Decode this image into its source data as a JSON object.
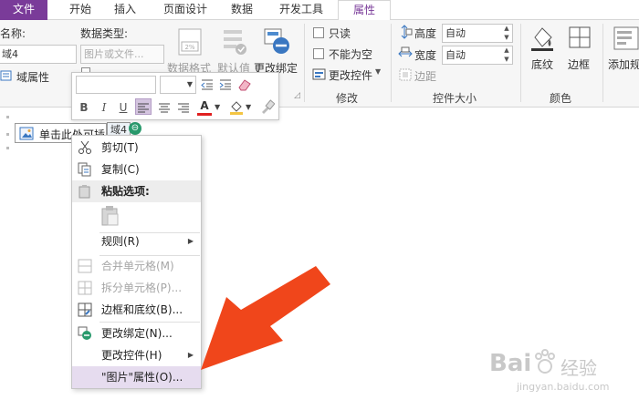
{
  "tabs": [
    {
      "label": "文件"
    },
    {
      "label": "开始"
    },
    {
      "label": "插入"
    },
    {
      "label": "页面设计"
    },
    {
      "label": "数据"
    },
    {
      "label": "开发工具"
    },
    {
      "label": "属性"
    }
  ],
  "ribbon": {
    "name_label": "名称:",
    "name_value": "域4",
    "field_props_label": "域属性",
    "data_type_label": "数据类型:",
    "data_type_value": "图片或文件...",
    "data_format_label": "数据格式",
    "data_format_badge": "2%",
    "default_value_label": "默认值",
    "change_binding_label": "更改绑定",
    "readonly_label": "只读",
    "not_empty_label": "不能为空",
    "change_control_label": "更改控件",
    "modify_group_label": "修改",
    "height_label": "高度",
    "height_value": "自动",
    "width_label": "宽度",
    "width_value": "自动",
    "margin_label": "边距",
    "control_size_group_label": "控件大小",
    "shading_label": "底纹",
    "border_label": "边框",
    "add_rule_label": "添加规",
    "color_group_label": "颜色"
  },
  "document": {
    "control_text": "单击此处可插",
    "control_tag": "域4"
  },
  "context_menu": {
    "cut": "剪切(T)",
    "copy": "复制(C)",
    "paste_options": "粘贴选项:",
    "rules": "规则(R)",
    "merge_cells": "合并单元格(M)",
    "split_cells": "拆分单元格(P)...",
    "borders_shading": "边框和底纹(B)...",
    "change_binding": "更改绑定(N)...",
    "change_control": "更改控件(H)",
    "picture_properties": "\"图片\"属性(O)..."
  },
  "watermark": {
    "brand": "Bai",
    "brand_cn": "经验",
    "url": "jingyan.baidu.com"
  },
  "colors": {
    "file_tab": "#7a3b99",
    "accent": "#7a3b99",
    "arrow": "#f0461b",
    "menu_highlight": "#e6dcef",
    "font_color_bar": "#e02020"
  },
  "icons": [
    "cut-icon",
    "copy-icon",
    "paste-icon",
    "merge-cells-icon",
    "split-cells-icon",
    "borders-icon",
    "change-binding-icon",
    "field-properties-icon",
    "data-format-icon",
    "default-value-icon",
    "shading-icon",
    "border-icon",
    "add-rule-icon",
    "height-icon",
    "width-icon",
    "margin-icon",
    "annotation-arrow-icon"
  ]
}
